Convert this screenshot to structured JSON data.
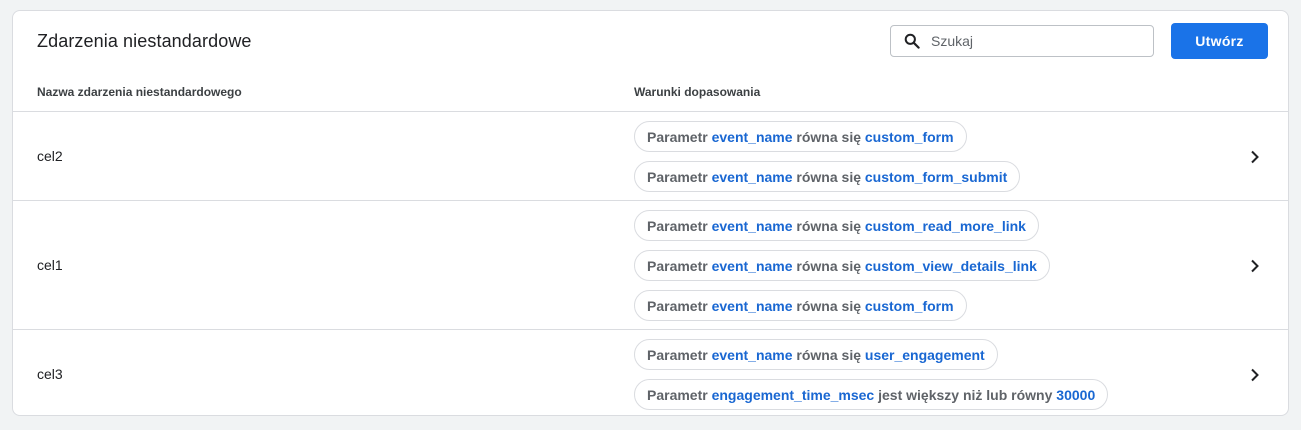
{
  "header": {
    "title": "Zdarzenia niestandardowe",
    "search_placeholder": "Szukaj",
    "create_label": "Utwórz"
  },
  "columns": {
    "name": "Nazwa zdarzenia niestandardowego",
    "conditions": "Warunki dopasowania"
  },
  "rows": [
    {
      "name": "cel2",
      "conditions": [
        {
          "prefix": "Parametr ",
          "param": "event_name",
          "op": " równa się ",
          "value": "custom_form"
        },
        {
          "prefix": "Parametr ",
          "param": "event_name",
          "op": " równa się ",
          "value": "custom_form_submit"
        }
      ]
    },
    {
      "name": "cel1",
      "conditions": [
        {
          "prefix": "Parametr ",
          "param": "event_name",
          "op": " równa się ",
          "value": "custom_read_more_link"
        },
        {
          "prefix": "Parametr ",
          "param": "event_name",
          "op": " równa się ",
          "value": "custom_view_details_link"
        },
        {
          "prefix": "Parametr ",
          "param": "event_name",
          "op": " równa się ",
          "value": "custom_form"
        }
      ]
    },
    {
      "name": "cel3",
      "conditions": [
        {
          "prefix": "Parametr ",
          "param": "event_name",
          "op": " równa się ",
          "value": "user_engagement"
        },
        {
          "prefix": "Parametr ",
          "param": "engagement_time_msec",
          "op": " jest większy niż lub równy ",
          "value": "30000"
        }
      ]
    }
  ],
  "icons": {
    "search": "search-icon",
    "row_open": "chevron-right-icon"
  },
  "colors": {
    "accent": "#1a73e8",
    "link": "#1967d2",
    "border": "#dadce0",
    "background": "#f1f3f4"
  }
}
